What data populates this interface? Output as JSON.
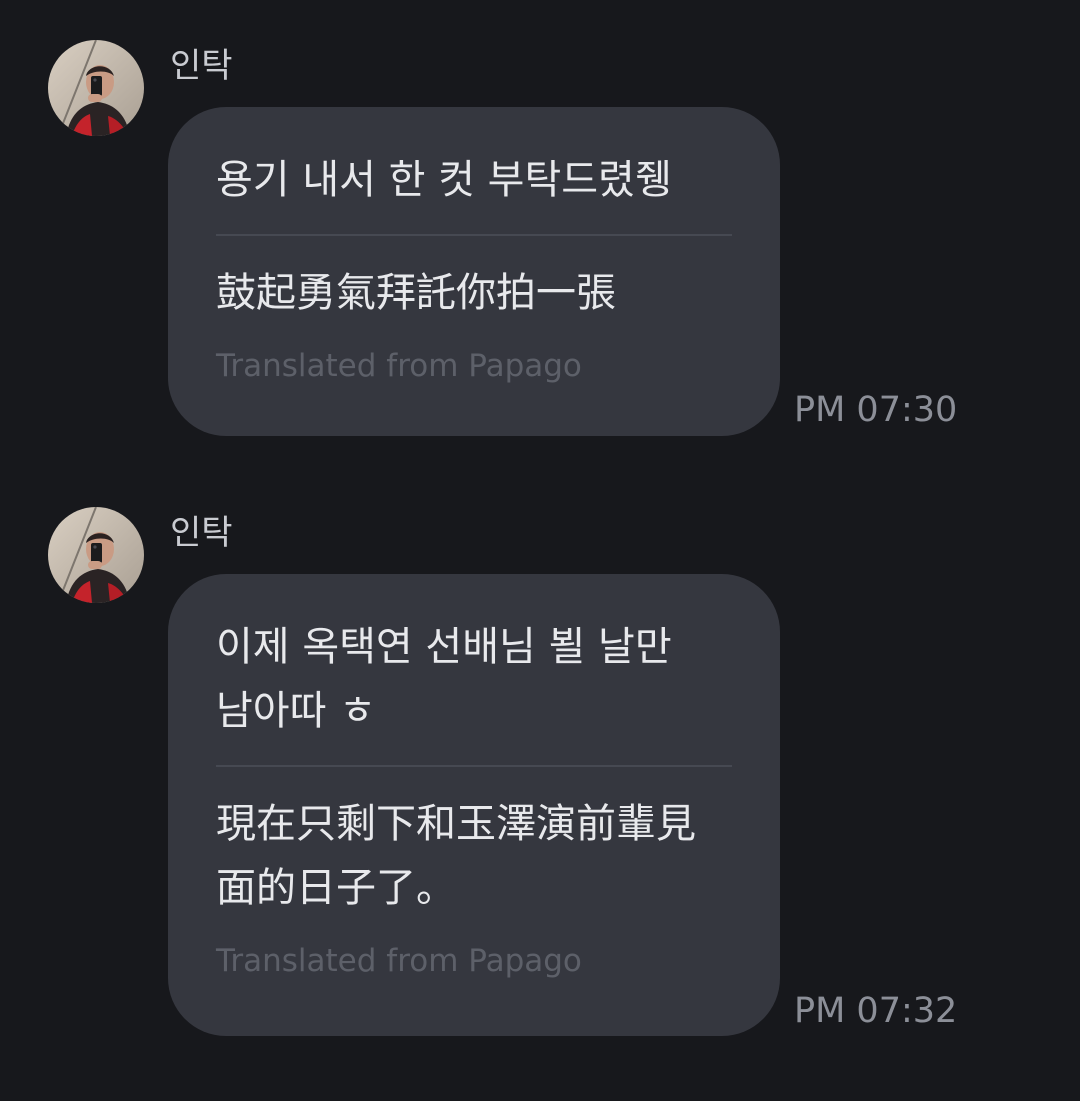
{
  "messages": [
    {
      "sender": "인탁",
      "original": "용기 내서 한 컷 부탁드렸쥉",
      "translation": "鼓起勇氣拜託你拍一張",
      "translation_source": "Translated from Papago",
      "time": "PM 07:30"
    },
    {
      "sender": "인탁",
      "original": "이제 옥택연 선배님 뵐 날만 남아따 ㅎ",
      "translation": "現在只剩下和玉澤演前輩見面的日子了。",
      "translation_source": "Translated from Papago",
      "time": "PM 07:32"
    }
  ],
  "colors": {
    "background": "#17181c",
    "bubble": "#35373f",
    "text": "#e8e9ec",
    "muted": "#5d6069",
    "timestamp": "#8c8f98"
  },
  "icons": {
    "avatar": "profile-photo"
  }
}
